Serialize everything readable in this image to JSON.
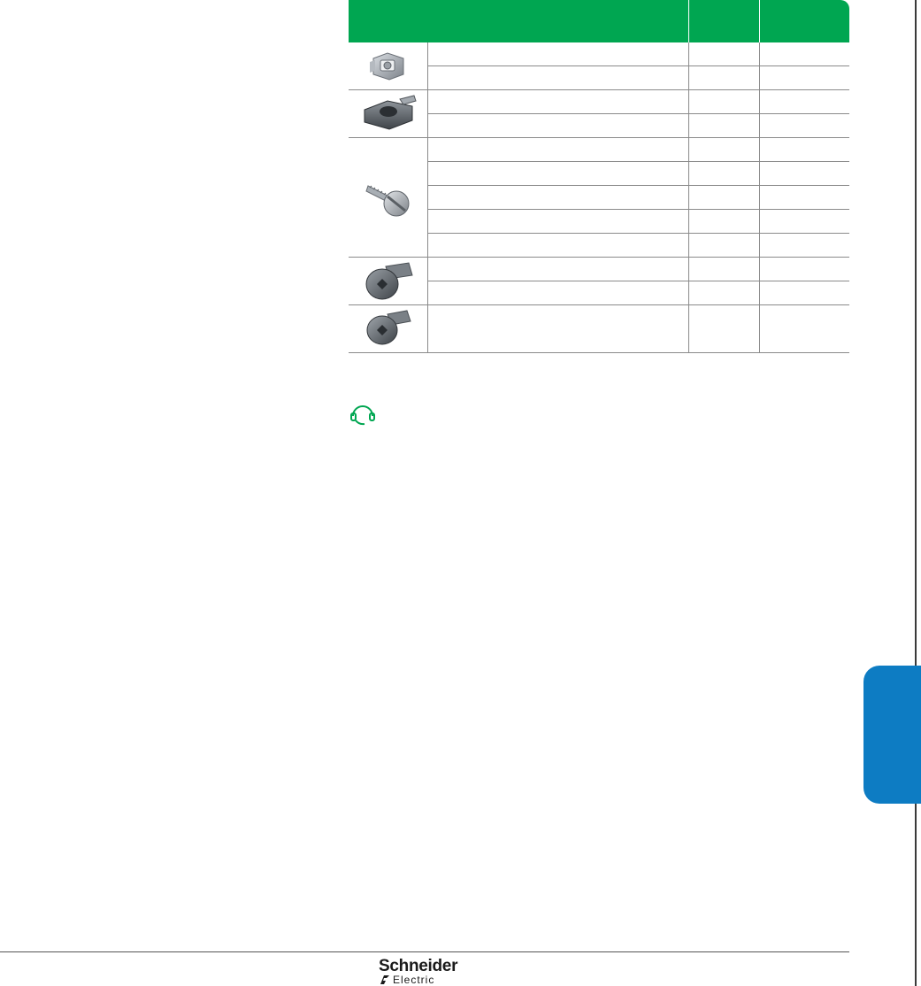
{
  "table": {
    "header": {
      "col1": "",
      "col2": "",
      "col3": ""
    },
    "groups": [
      {
        "image": "cage-nut-clip",
        "rows": 2
      },
      {
        "image": "cage-nut",
        "rows": 2
      },
      {
        "image": "slotted-screw",
        "rows": 5
      },
      {
        "image": "torx-screw",
        "rows": 2
      },
      {
        "image": "torx-screw-short",
        "rows": 1
      }
    ]
  },
  "support_icon": "headset-icon",
  "colors": {
    "header_green": "#00a651",
    "tab_blue": "#0d7cc3"
  },
  "footer": {
    "brand_name": "Schneider",
    "brand_sub": "Electric"
  }
}
